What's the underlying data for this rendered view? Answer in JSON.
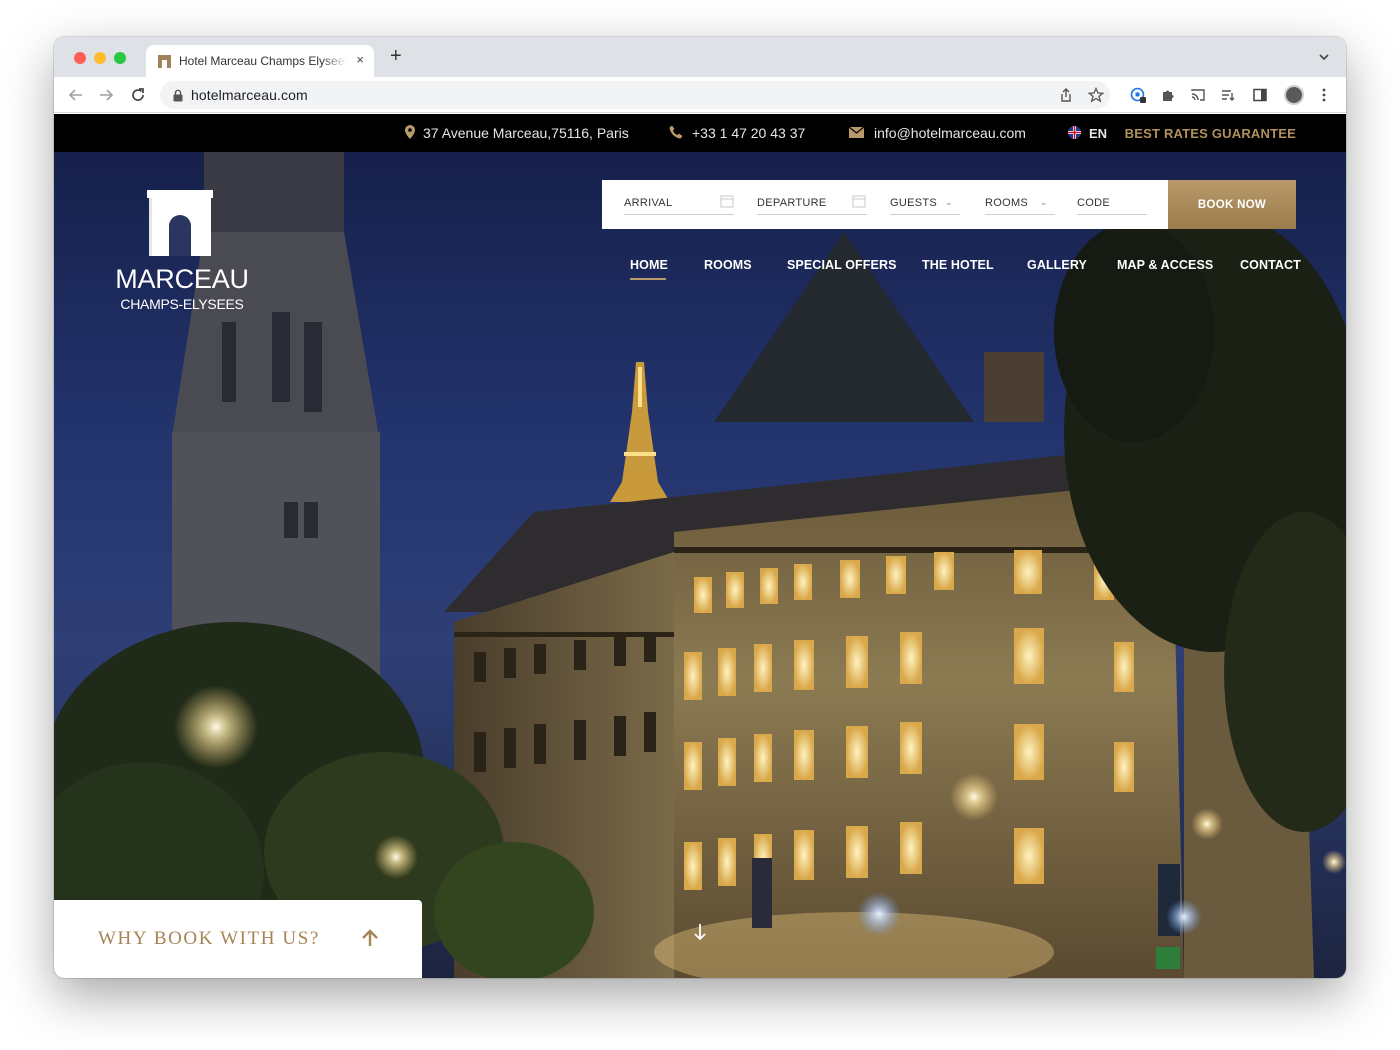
{
  "browser": {
    "tab_title": "Hotel Marceau Champs Elysees",
    "new_tab_label": "+",
    "close_label": "×",
    "url": "hotelmarceau.com"
  },
  "topbar": {
    "address": "37 Avenue Marceau,75116, Paris",
    "phone": "+33 1 47 20 43 37",
    "email": "info@hotelmarceau.com",
    "language": "EN",
    "rates": "BEST RATES GUARANTEE"
  },
  "logo": {
    "name": "MARCEAU",
    "subtitle": "CHAMPS-ELYSEES"
  },
  "booking": {
    "arrival": "ARRIVAL",
    "departure": "DEPARTURE",
    "guests": "GUESTS",
    "rooms": "ROOMS",
    "code": "CODE",
    "book_now": "BOOK NOW"
  },
  "nav": {
    "items": [
      {
        "label": "HOME",
        "active": true
      },
      {
        "label": "ROOMS",
        "active": false
      },
      {
        "label": "SPECIAL OFFERS",
        "active": false
      },
      {
        "label": "THE HOTEL",
        "active": false
      },
      {
        "label": "GALLERY",
        "active": false
      },
      {
        "label": "MAP & ACCESS",
        "active": false
      },
      {
        "label": "CONTACT",
        "active": false
      }
    ]
  },
  "why_book": {
    "label": "WHY BOOK WITH US?"
  },
  "colors": {
    "accent_gold": "#b8996a",
    "topbar_bg": "#000000",
    "book_button": "#a88a5b"
  },
  "icons": [
    "chrome-back-icon",
    "chrome-forward-icon",
    "reload-icon",
    "lock-icon",
    "share-icon",
    "star-icon",
    "extension-icon",
    "puzzle-icon",
    "cast-icon",
    "reading-list-icon",
    "sidebar-icon",
    "menu-dots-icon",
    "map-pin-icon",
    "phone-icon",
    "envelope-icon",
    "uk-flag-icon",
    "calendar-icon",
    "chevron-down-icon",
    "arrow-up-icon",
    "arrow-down-icon"
  ]
}
